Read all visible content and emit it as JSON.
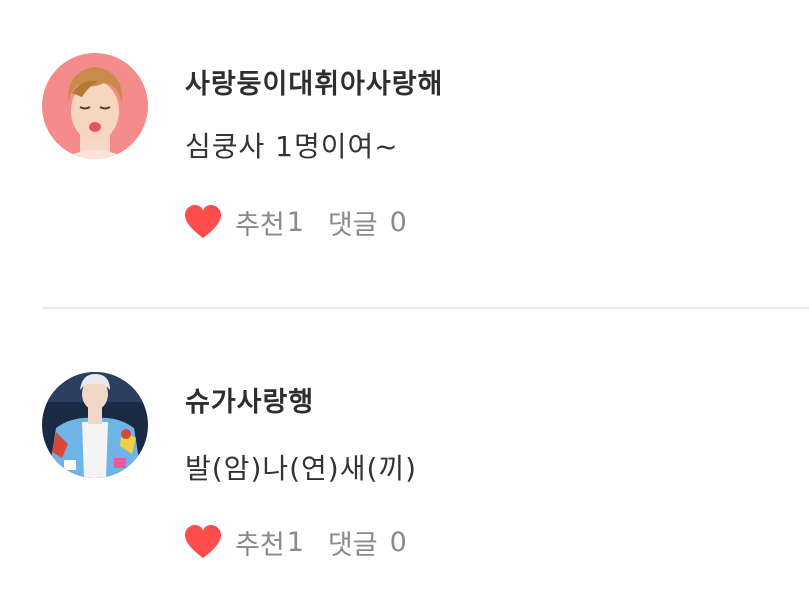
{
  "comments": [
    {
      "nickname": "사랑둥이대휘아사랑해",
      "text": "심쿵사 1명이여~",
      "like_label": "추천",
      "like_count": "1",
      "reply_label": "댓글",
      "reply_count": "0"
    },
    {
      "nickname": "슈가사랑행",
      "text": "발(암)나(연)새(끼)",
      "like_label": "추천",
      "like_count": "1",
      "reply_label": "댓글",
      "reply_count": "0"
    }
  ],
  "colors": {
    "heart": "#ff4d4d",
    "meta_text": "#8a8a8a",
    "divider": "#e8e8e8",
    "avatar1_bg": "#f58b8b"
  },
  "icons": {
    "like": "heart-icon"
  }
}
